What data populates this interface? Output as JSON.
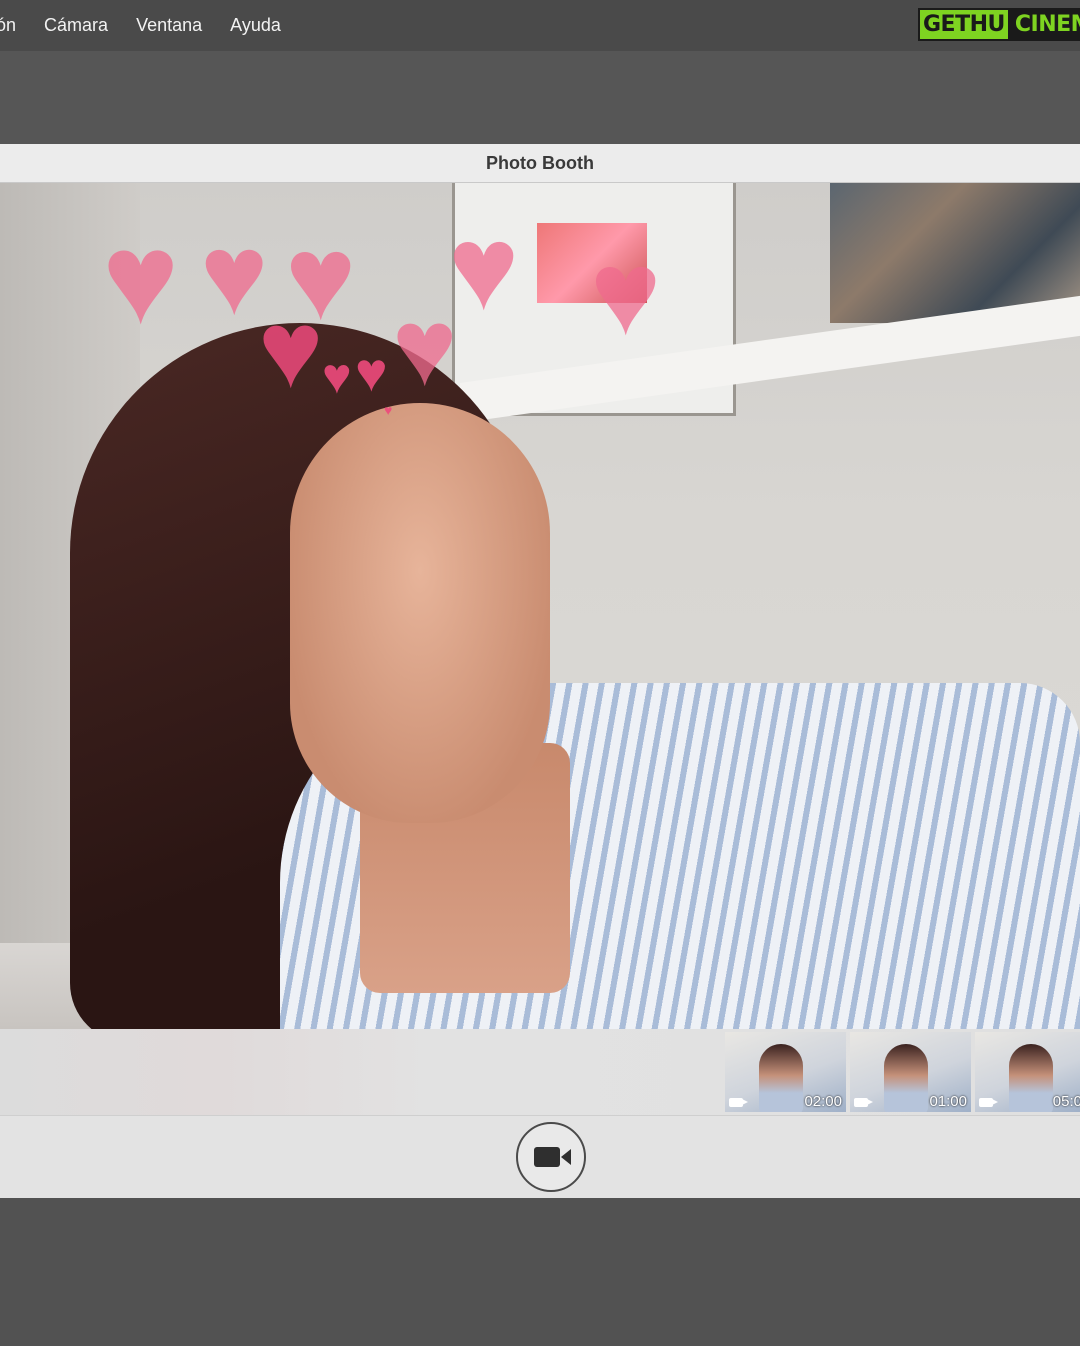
{
  "menubar": {
    "items": [
      "ón",
      "Cámara",
      "Ventana",
      "Ayuda"
    ]
  },
  "logo": {
    "part1": "GETHU",
    "part2": "CINEMA"
  },
  "window": {
    "title": "Photo Booth"
  },
  "filmstrip": {
    "thumbnails": [
      {
        "duration": "02:00"
      },
      {
        "duration": "01:00"
      },
      {
        "duration": "05:0"
      }
    ]
  },
  "colors": {
    "accent_logo": "#7ed321",
    "hearts": "#f06a8e"
  },
  "icons": {
    "record": "video-camera-icon",
    "thumb_type": "video-icon"
  }
}
